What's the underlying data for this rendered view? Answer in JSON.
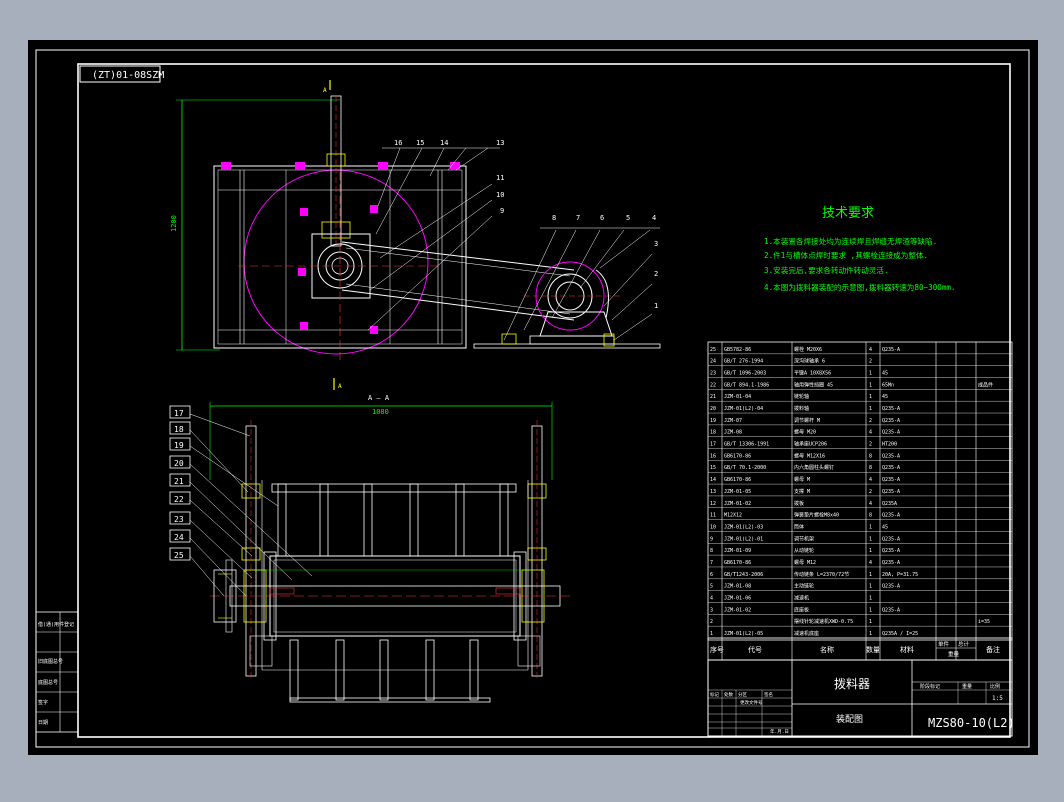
{
  "drawing": {
    "title_block_rotated": "(ZT)01-08SZM",
    "tech_requirements": {
      "heading": "技术要求",
      "items": [
        "1.本装置各焊接处均为连续焊且焊缝无焊渣等缺陷.",
        "2.件1与槽体点焊时要求 ,其螺栓连接成为整体.",
        "3.安装完后,要求各转动件转动灵活.",
        "4.本图为拨料器装配的示意图,拨料器转速为80~300mm."
      ]
    },
    "view_labels": {
      "section": "A — A",
      "width_dim": "1080",
      "height_dim": "1200",
      "a_top": "A",
      "a_bottom": "A"
    },
    "top_balloons": [
      "16",
      "15",
      "14",
      "13",
      "11",
      "10",
      "9",
      "8",
      "7",
      "6",
      "5",
      "4",
      "3",
      "2",
      "1"
    ],
    "left_balloons": [
      "17",
      "18",
      "19",
      "20",
      "21",
      "22",
      "23",
      "24",
      "25"
    ],
    "bom_rows": [
      {
        "no": "25",
        "code": "GB5782-86",
        "name": "螺栓 M20X6",
        "qty": "4",
        "mat": "Q235-A",
        "note": ""
      },
      {
        "no": "24",
        "code": "GB/T 276-1994",
        "name": "深沟球轴承 6",
        "qty": "2",
        "mat": "",
        "note": ""
      },
      {
        "no": "23",
        "code": "GB/T 1096-2003",
        "name": "平键A 10X8X56",
        "qty": "1",
        "mat": "45",
        "note": ""
      },
      {
        "no": "22",
        "code": "GB/T 894.1-1986",
        "name": "轴用弹性挡圈 45",
        "qty": "1",
        "mat": "65Mn",
        "note": "成品件"
      },
      {
        "no": "21",
        "code": "JZM-01-04",
        "name": "链轮轴",
        "qty": "1",
        "mat": "45",
        "note": ""
      },
      {
        "no": "20",
        "code": "JZM-01(L2)-04",
        "name": "拨料轴",
        "qty": "1",
        "mat": "Q235-A",
        "note": ""
      },
      {
        "no": "19",
        "code": "JZM-07",
        "name": "调节螺杆 M",
        "qty": "2",
        "mat": "Q235-A",
        "note": ""
      },
      {
        "no": "18",
        "code": "JZM-08",
        "name": "螺母 M20",
        "qty": "4",
        "mat": "Q235-A",
        "note": ""
      },
      {
        "no": "17",
        "code": "GB/T 13306-1991",
        "name": "轴承座UCP206",
        "qty": "2",
        "mat": "HT200",
        "note": ""
      },
      {
        "no": "16",
        "code": "GB6170-86",
        "name": "螺母 M12X16",
        "qty": "8",
        "mat": "Q235-A",
        "note": ""
      },
      {
        "no": "15",
        "code": "GB/T 70.1-2000",
        "name": "内六角圆柱头螺钉",
        "qty": "8",
        "mat": "Q235-A",
        "note": ""
      },
      {
        "no": "14",
        "code": "GB6170-86",
        "name": "螺母 M",
        "qty": "4",
        "mat": "Q235-A",
        "note": ""
      },
      {
        "no": "13",
        "code": "JZM-01-05",
        "name": "支撑 M",
        "qty": "2",
        "mat": "Q235-A",
        "note": ""
      },
      {
        "no": "12",
        "code": "JZM-01-02",
        "name": "拨板",
        "qty": "4",
        "mat": "Q235A",
        "note": ""
      },
      {
        "no": "11",
        "code": "M12X12",
        "name": "弹簧垫片螺栓M8x40",
        "qty": "8",
        "mat": "Q235-A",
        "note": ""
      },
      {
        "no": "10",
        "code": "JZM-01(L2)-03",
        "name": "筒体",
        "qty": "1",
        "mat": "45",
        "note": ""
      },
      {
        "no": "9",
        "code": "JZM-01(L2)-01",
        "name": "调节机架",
        "qty": "1",
        "mat": "Q235-A",
        "note": ""
      },
      {
        "no": "8",
        "code": "JZM-01-09",
        "name": "从动链轮",
        "qty": "1",
        "mat": "Q235-A",
        "note": ""
      },
      {
        "no": "7",
        "code": "GB6170-86",
        "name": "螺母 M12",
        "qty": "4",
        "mat": "Q235-A",
        "note": ""
      },
      {
        "no": "6",
        "code": "GB/T1243-2006",
        "name": "传动链条 L=2370/72节",
        "qty": "1",
        "mat": "20A, P=31.75",
        "note": ""
      },
      {
        "no": "5",
        "code": "JZM-01-08",
        "name": "主动链轮",
        "qty": "1",
        "mat": "Q235-A",
        "note": ""
      },
      {
        "no": "4",
        "code": "JZM-01-06",
        "name": "减速机",
        "qty": "1",
        "mat": "",
        "note": ""
      },
      {
        "no": "3",
        "code": "JZM-01-02",
        "name": "底座板",
        "qty": "1",
        "mat": "Q235-A",
        "note": ""
      },
      {
        "no": "2",
        "code": "",
        "name": "摆线针轮减速机XWD-0.75",
        "qty": "1",
        "mat": "",
        "note": "i=35"
      },
      {
        "no": "1",
        "code": "JZM-01(L2)-05",
        "name": "减速机底座",
        "qty": "1",
        "mat": "Q235A / I=25",
        "note": ""
      }
    ],
    "bom_header": {
      "no": "序号",
      "code": "代号",
      "name": "名称",
      "qty": "数量",
      "mat": "材料",
      "unit_w": "单件",
      "total_w": "总计",
      "note": "备注",
      "weight": "重量"
    },
    "title_block": {
      "part_name": "拨料器",
      "sub_name": "装配图",
      "drawing_no": "MZS80-10(L2)",
      "scale": "1:5",
      "labels": [
        "标记",
        "处数",
        "分区",
        "更改文件号",
        "签名",
        "年.月.日"
      ],
      "right_labels": [
        "阶段标记",
        "重量",
        "比例"
      ]
    },
    "left_strip": [
      "借(通)用件登记",
      "旧底图总号",
      "底图总号",
      "签字",
      "日期"
    ],
    "colors": {
      "paper": "#000000",
      "frame": "#ffffff",
      "green": "#00ff00",
      "magenta": "#ff00ff",
      "red": "#ff3030",
      "yellow": "#ffff00",
      "cyan": "#00ffff"
    }
  }
}
